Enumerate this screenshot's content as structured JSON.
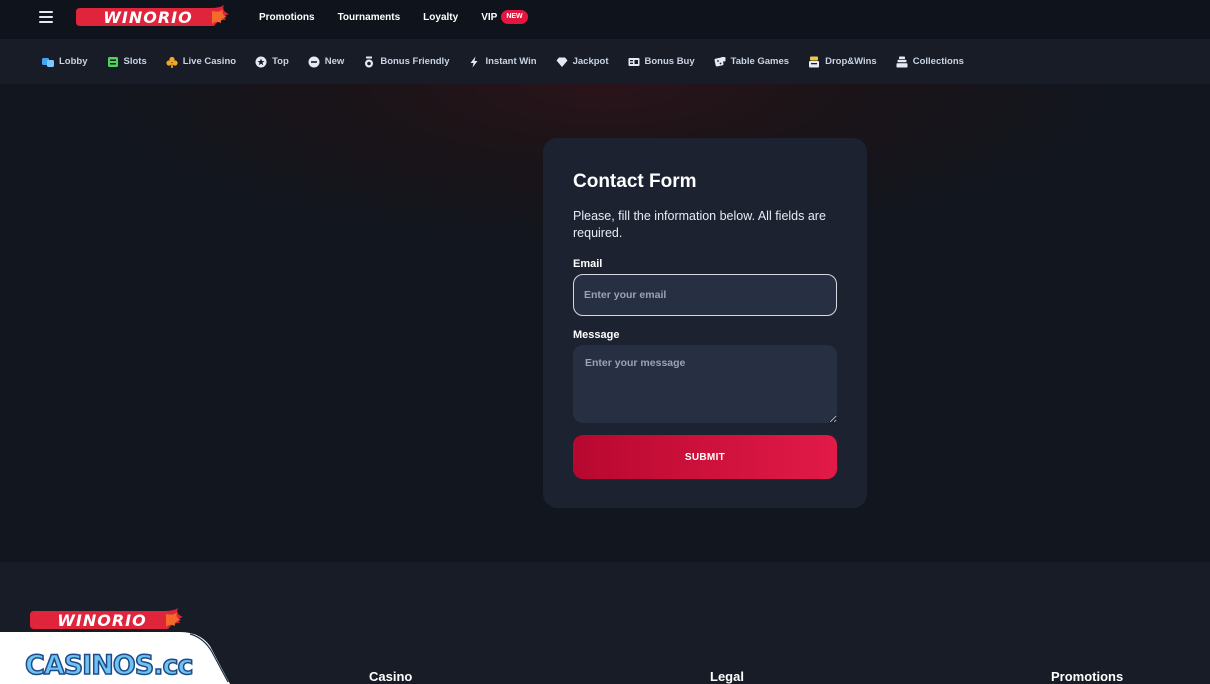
{
  "header": {
    "brand": "WINORIO",
    "nav": [
      {
        "label": "Promotions"
      },
      {
        "label": "Tournaments"
      },
      {
        "label": "Loyalty"
      },
      {
        "label": "VIP",
        "badge": "NEW"
      }
    ]
  },
  "categories": [
    {
      "label": "Lobby",
      "icon": "lobby-icon"
    },
    {
      "label": "Slots",
      "icon": "slots-icon"
    },
    {
      "label": "Live Casino",
      "icon": "club-icon"
    },
    {
      "label": "Top",
      "icon": "star-icon"
    },
    {
      "label": "New",
      "icon": "new-icon"
    },
    {
      "label": "Bonus Friendly",
      "icon": "bonus-icon"
    },
    {
      "label": "Instant Win",
      "icon": "bolt-icon"
    },
    {
      "label": "Jackpot",
      "icon": "diamond-icon"
    },
    {
      "label": "Bonus Buy",
      "icon": "ticket-icon"
    },
    {
      "label": "Table Games",
      "icon": "dice-icon"
    },
    {
      "label": "Drop&Wins",
      "icon": "drop-icon"
    },
    {
      "label": "Collections",
      "icon": "collections-icon"
    }
  ],
  "form": {
    "title": "Contact Form",
    "description": "Please, fill the information below. All fields are required.",
    "email_label": "Email",
    "email_placeholder": "Enter your email",
    "email_value": "",
    "message_label": "Message",
    "message_placeholder": "Enter your message",
    "message_value": "",
    "submit_label": "SUBMIT"
  },
  "footer": {
    "brand": "WINORIO",
    "columns": [
      {
        "title": "Casino"
      },
      {
        "title": "Legal"
      },
      {
        "title": "Promotions"
      }
    ]
  },
  "watermark": {
    "text": "CASINOS.cc"
  },
  "colors": {
    "accent": "#e21a47",
    "background": "#12161f",
    "card": "#1c2230",
    "input": "#273043"
  }
}
